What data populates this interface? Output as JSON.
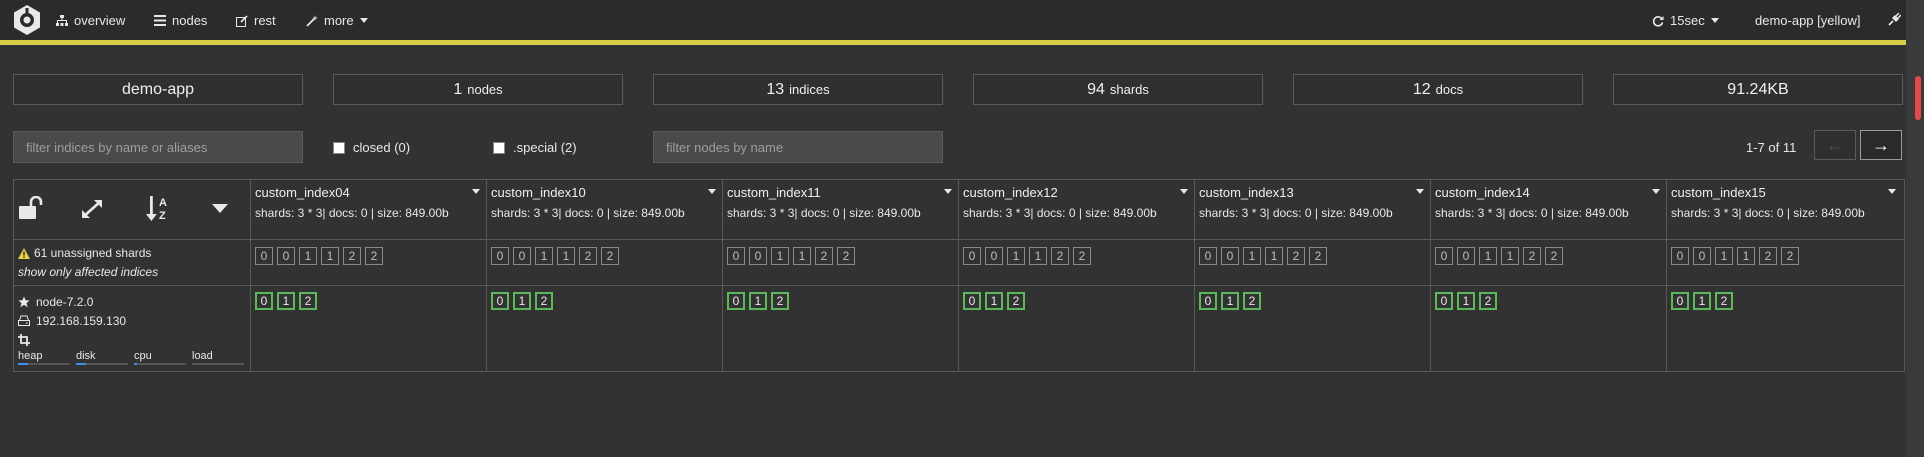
{
  "nav": {
    "items": [
      {
        "label": "overview",
        "icon": "sitemap-icon"
      },
      {
        "label": "nodes",
        "icon": "list-icon"
      },
      {
        "label": "rest",
        "icon": "edit-icon"
      },
      {
        "label": "more",
        "icon": "magic-wand-icon"
      }
    ],
    "refresh_label": "15sec",
    "cluster_label": "demo-app [yellow]",
    "accent_color": "#d6cf45"
  },
  "stats": [
    {
      "value": "demo-app",
      "label": ""
    },
    {
      "value": "1",
      "label": "nodes"
    },
    {
      "value": "13",
      "label": "indices"
    },
    {
      "value": "94",
      "label": "shards"
    },
    {
      "value": "12",
      "label": "docs"
    },
    {
      "value": "91.24KB",
      "label": ""
    }
  ],
  "filters": {
    "indices_placeholder": "filter indices by name or aliases",
    "closed_label": "closed (0)",
    "special_label": ".special (2)",
    "nodes_placeholder": "filter nodes by name"
  },
  "pager": {
    "text": "1-7 of 11",
    "prev": "←",
    "next": "→"
  },
  "unassigned": {
    "label": "61 unassigned shards",
    "link": "show only affected indices"
  },
  "node": {
    "name": "node-7.2.0",
    "ip": "192.168.159.130",
    "metrics": [
      "heap",
      "disk",
      "cpu",
      "load"
    ],
    "metric_fill": [
      0.2,
      0.2,
      0.05,
      0.0
    ]
  },
  "indices": [
    {
      "name": "custom_index04",
      "meta": "shards: 3 * 3| docs: 0 | size: 849.00b"
    },
    {
      "name": "custom_index10",
      "meta": "shards: 3 * 3| docs: 0 | size: 849.00b"
    },
    {
      "name": "custom_index11",
      "meta": "shards: 3 * 3| docs: 0 | size: 849.00b"
    },
    {
      "name": "custom_index12",
      "meta": "shards: 3 * 3| docs: 0 | size: 849.00b"
    },
    {
      "name": "custom_index13",
      "meta": "shards: 3 * 3| docs: 0 | size: 849.00b"
    },
    {
      "name": "custom_index14",
      "meta": "shards: 3 * 3| docs: 0 | size: 849.00b"
    },
    {
      "name": "custom_index15",
      "meta": "shards: 3 * 3| docs: 0 | size: 849.00b"
    }
  ],
  "unassigned_shards": [
    "0",
    "0",
    "1",
    "1",
    "2",
    "2"
  ],
  "assigned_shards": [
    "0",
    "1",
    "2"
  ]
}
